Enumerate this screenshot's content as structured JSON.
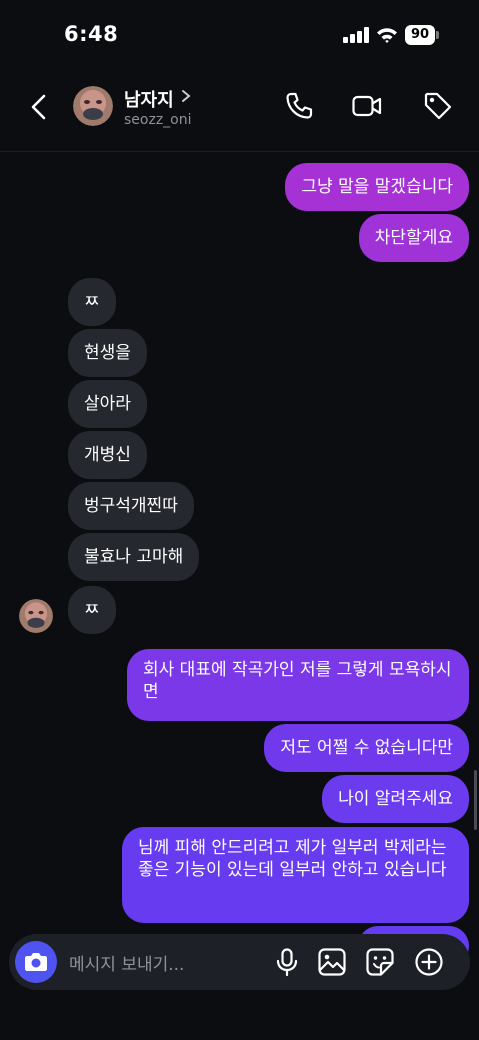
{
  "status_bar": {
    "time": "6:48",
    "battery": "90"
  },
  "header": {
    "contact_name": "남자지",
    "username": "seozz_oni"
  },
  "messages": [
    {
      "dir": "sent",
      "text": "그냥 말을 말겠습니다"
    },
    {
      "dir": "sent",
      "text": "차단할게요"
    },
    {
      "dir": "received",
      "text": "ㅉ"
    },
    {
      "dir": "received",
      "text": "현생을"
    },
    {
      "dir": "received",
      "text": "살아라"
    },
    {
      "dir": "received",
      "text": "개병신"
    },
    {
      "dir": "received",
      "text": "벙구석개찐따"
    },
    {
      "dir": "received",
      "text": "불효나 고마해"
    },
    {
      "dir": "received",
      "text": "ㅉ"
    },
    {
      "dir": "sent",
      "text": "회사 대표에 작곡가인 저를 그렇게 모욕하시면"
    },
    {
      "dir": "sent",
      "text": "저도 어쩔 수 없습니다만"
    },
    {
      "dir": "sent",
      "text": "나이 알려주세요"
    },
    {
      "dir": "sent",
      "text": "님께 피해 안드리려고 제가 일부러 박제라는 좋은 기능이 있는데 일부러 안하고 있습니다"
    }
  ],
  "composer": {
    "placeholder": "메시지 보내기..."
  },
  "icons": {
    "back": "chevron-left-icon",
    "call": "phone-icon",
    "video": "video-camera-icon",
    "tag": "tag-icon",
    "camera": "camera-icon",
    "mic": "microphone-icon",
    "gallery": "image-icon",
    "sticker": "sticker-icon",
    "add": "plus-circle-icon"
  },
  "colors": {
    "background": "#0b0d11",
    "received_bubble": "#262830",
    "sent_top": "#a632d6",
    "sent_bottom": "#6a3cf0",
    "accent": "#4f54f0"
  }
}
